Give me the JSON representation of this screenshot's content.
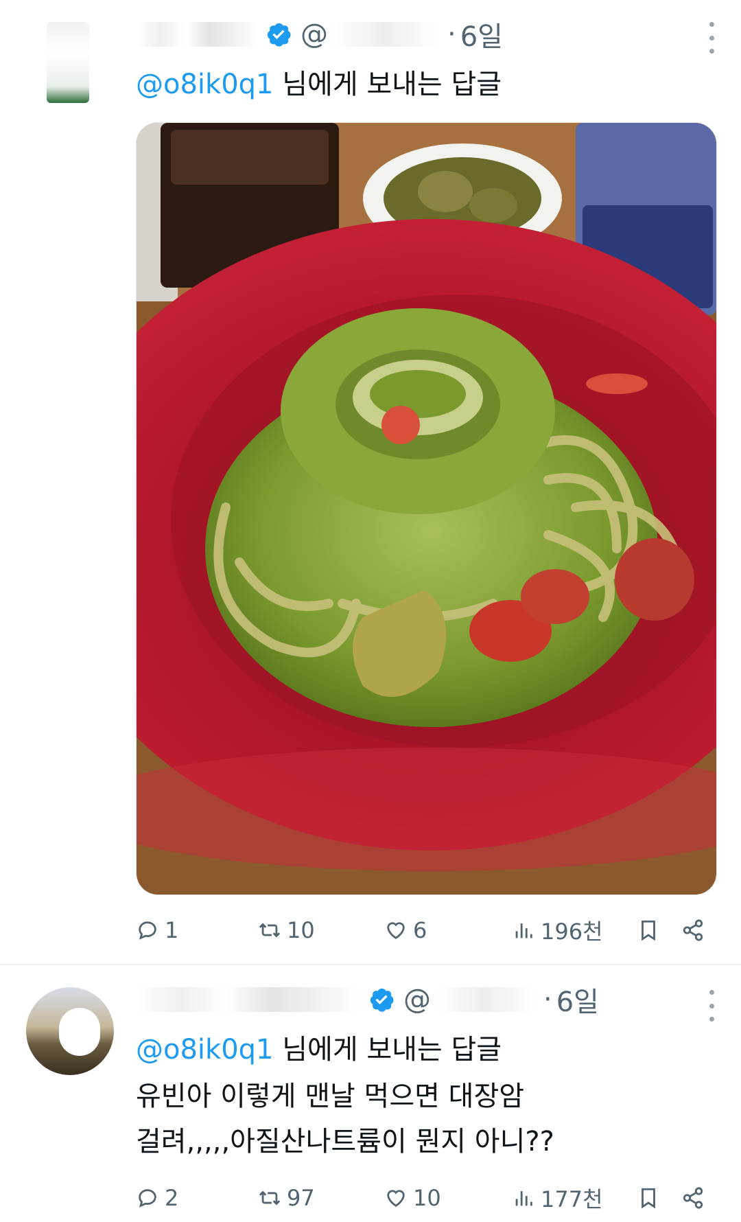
{
  "colors": {
    "link": "#1d9bf0",
    "secondary": "#536471",
    "verified": "#1d9bf0",
    "plate": "#b8182c",
    "pesto": "#7a9a2e"
  },
  "tweet1": {
    "time": "6일",
    "replying_prefix": "@o8ik0q1",
    "replying_suffix": " 님에게 보내는 답글",
    "stats": {
      "replies": "1",
      "retweets": "10",
      "likes": "6",
      "views": "196천"
    }
  },
  "tweet2": {
    "time": "6일",
    "replying_prefix": "@o8ik0q1",
    "replying_suffix": " 님에게 보내는 답글",
    "text_line1": "유빈아 이렇게 맨날 먹으면 대장암",
    "text_line2": "걸려,,,,,아질산나트륨이 뭔지 아니??",
    "stats": {
      "replies": "2",
      "retweets": "97",
      "likes": "10",
      "views": "177천"
    }
  },
  "icons": [
    "verified-badge-icon",
    "more-icon",
    "reply-icon",
    "retweet-icon",
    "like-icon",
    "views-icon",
    "bookmark-icon",
    "share-icon"
  ]
}
